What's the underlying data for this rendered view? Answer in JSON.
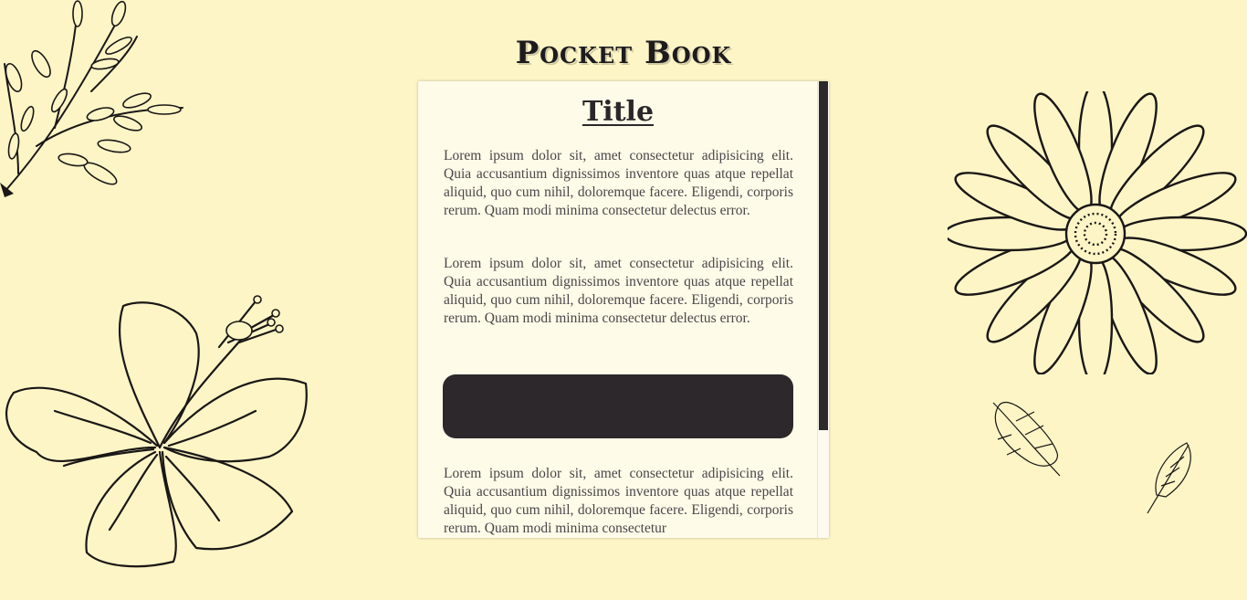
{
  "app": {
    "title": "Pocket Book"
  },
  "card": {
    "title": "Title",
    "paragraphs": [
      "Lorem ipsum dolor sit, amet consectetur adipisicing elit. Quia accusantium dignissimos inventore quas atque repellat aliquid, quo cum nihil, doloremque facere. Eligendi, corporis rerum. Quam modi minima consectetur delectus error.",
      "Lorem ipsum dolor sit, amet consectetur adipisicing elit. Quia accusantium dignissimos inventore quas atque repellat aliquid, quo cum nihil, doloremque facere. Eligendi, corporis rerum. Quam modi minima consectetur delectus error.",
      "Lorem ipsum dolor sit, amet consectetur adipisicing elit. Quia accusantium dignissimos inventore quas atque repellat aliquid, quo cum nihil, doloremque facere. Eligendi, corporis rerum. Quam modi minima consectetur"
    ]
  },
  "decorations": {
    "top_left": "fern-branch-icon",
    "bottom_left": "hibiscus-flower-icon",
    "right": "daisy-flower-icon",
    "small_leaf_1": "oak-leaf-icon",
    "small_leaf_2": "small-leaf-icon"
  },
  "colors": {
    "background": "#fdf5c6",
    "card": "#fffbe9",
    "dark": "#2c282b",
    "text": "#4a4548"
  }
}
